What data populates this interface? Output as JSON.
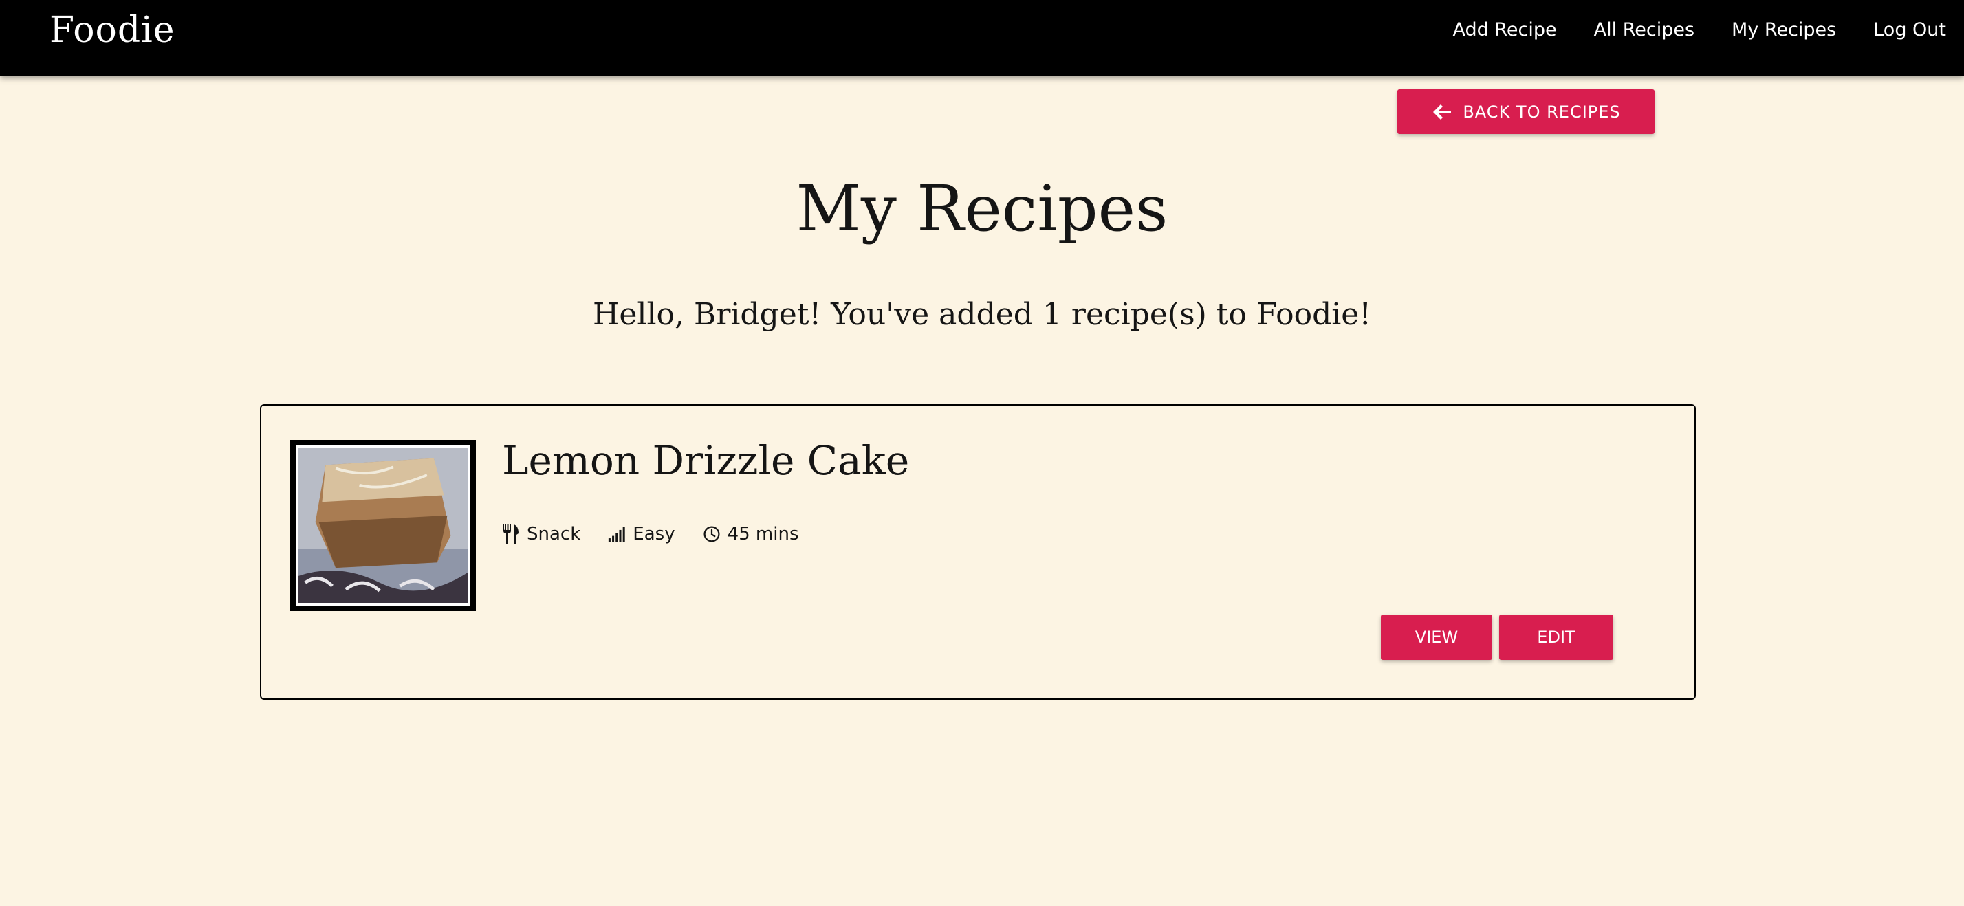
{
  "nav": {
    "brand": "Foodie",
    "links": [
      {
        "label": "Add Recipe"
      },
      {
        "label": "All Recipes"
      },
      {
        "label": "My Recipes"
      },
      {
        "label": "Log Out"
      }
    ]
  },
  "back_button": {
    "label": "Back to Recipes",
    "icon": "arrow-left-icon"
  },
  "page": {
    "title": "My Recipes",
    "greeting": "Hello, Bridget! You've added 1 recipe(s) to Foodie!"
  },
  "recipes": [
    {
      "title": "Lemon Drizzle Cake",
      "image": "lemon-drizzle-cake-photo",
      "category": {
        "label": "Snack",
        "icon": "utensils-icon"
      },
      "difficulty": {
        "label": "Easy",
        "icon": "signal-bars-icon"
      },
      "time": {
        "label": "45 mins",
        "icon": "clock-icon"
      },
      "view_label": "View",
      "edit_label": "Edit"
    }
  ],
  "colors": {
    "background": "#fcf4e3",
    "navbar": "#000000",
    "accent": "#d81e4f",
    "text": "#151515"
  }
}
